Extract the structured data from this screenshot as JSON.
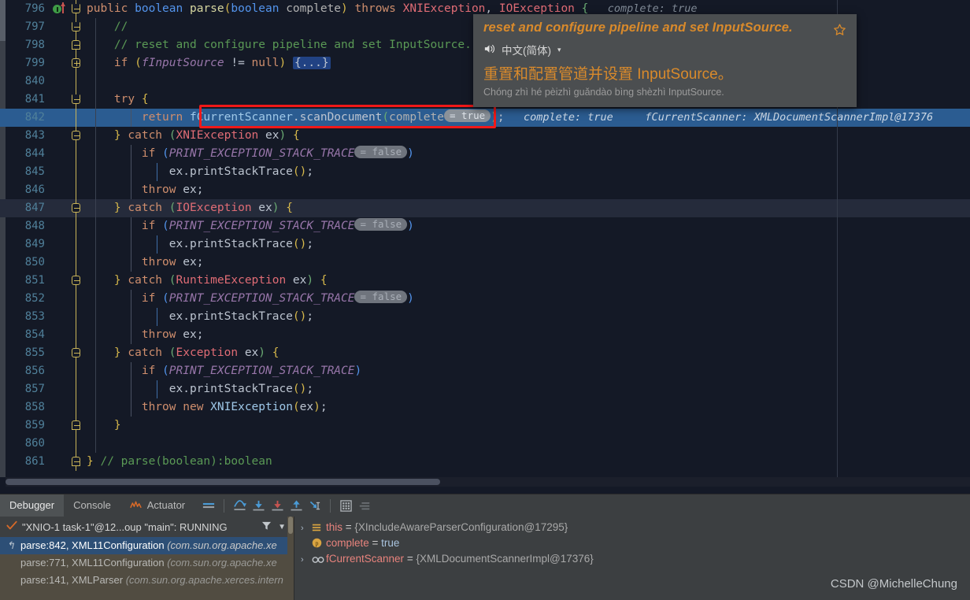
{
  "editor": {
    "lines": [
      {
        "num": "796",
        "indent": 0,
        "segments": [
          {
            "t": "public",
            "c": "kw"
          },
          {
            "t": " ",
            "c": "punc"
          },
          {
            "t": "boolean",
            "c": "kw2"
          },
          {
            "t": " ",
            "c": "punc"
          },
          {
            "t": "parse",
            "c": "fn"
          },
          {
            "t": "(",
            "c": "brkt-y"
          },
          {
            "t": "boolean",
            "c": "kw2"
          },
          {
            "t": " ",
            "c": "punc"
          },
          {
            "t": "complete",
            "c": "par"
          },
          {
            "t": ")",
            "c": "brkt-y"
          },
          {
            "t": " ",
            "c": "punc"
          },
          {
            "t": "throws",
            "c": "kw"
          },
          {
            "t": " ",
            "c": "punc"
          },
          {
            "t": "XNIException",
            "c": "typ"
          },
          {
            "t": ", ",
            "c": "punc"
          },
          {
            "t": "IOException",
            "c": "typ"
          },
          {
            "t": " ",
            "c": "punc"
          },
          {
            "t": "{",
            "c": "brkt-g"
          },
          {
            "t": "   complete: true",
            "c": "inl"
          }
        ]
      },
      {
        "num": "797",
        "segments": [
          {
            "t": "    //",
            "c": "cmt"
          }
        ]
      },
      {
        "num": "798",
        "segments": [
          {
            "t": "    // reset and configure pipeline and set InputSource.",
            "c": "cmt"
          }
        ]
      },
      {
        "num": "799",
        "segments": [
          {
            "t": "    ",
            "c": "punc"
          },
          {
            "t": "if",
            "c": "kw"
          },
          {
            "t": " ",
            "c": "punc"
          },
          {
            "t": "(",
            "c": "brkt-y"
          },
          {
            "t": "fInputSource",
            "c": "fld"
          },
          {
            "t": " != ",
            "c": "punc"
          },
          {
            "t": "null",
            "c": "kw"
          },
          {
            "t": ")",
            "c": "brkt-y"
          },
          {
            "t": " ",
            "c": "punc"
          },
          {
            "t": "{...}",
            "c": "folded"
          }
        ]
      },
      {
        "num": "840",
        "segments": []
      },
      {
        "num": "841",
        "segments": [
          {
            "t": "    ",
            "c": "punc"
          },
          {
            "t": "try",
            "c": "kw"
          },
          {
            "t": " ",
            "c": "punc"
          },
          {
            "t": "{",
            "c": "brkt-y"
          }
        ]
      },
      {
        "num": "842",
        "exec": true,
        "segments": [
          {
            "t": "        ",
            "c": "punc"
          },
          {
            "t": "return",
            "c": "kw"
          },
          {
            "t": " ",
            "c": "punc"
          },
          {
            "t": "fCurrentScanner",
            "c": "var"
          },
          {
            "t": ".",
            "c": "punc"
          },
          {
            "t": "scanDocument",
            "c": "punc"
          },
          {
            "t": "(",
            "c": "brkt-g"
          },
          {
            "t": "complete",
            "c": "par"
          },
          {
            "t": "= true",
            "c": "hint-bright"
          },
          {
            "t": ")",
            "c": "brkt-g"
          },
          {
            "t": ";",
            "c": "punc"
          },
          {
            "t": "   complete: true     fCurrentScanner: XMLDocumentScannerImpl@17376",
            "c": "inl-on-blue"
          }
        ]
      },
      {
        "num": "843",
        "segments": [
          {
            "t": "    ",
            "c": "punc"
          },
          {
            "t": "}",
            "c": "brkt-y"
          },
          {
            "t": " ",
            "c": "punc"
          },
          {
            "t": "catch",
            "c": "kw"
          },
          {
            "t": " ",
            "c": "punc"
          },
          {
            "t": "(",
            "c": "brkt-g"
          },
          {
            "t": "XNIException",
            "c": "typ"
          },
          {
            "t": " ex",
            "c": "punc"
          },
          {
            "t": ")",
            "c": "brkt-g"
          },
          {
            "t": " ",
            "c": "punc"
          },
          {
            "t": "{",
            "c": "brkt-y"
          }
        ]
      },
      {
        "num": "844",
        "segments": [
          {
            "t": "        ",
            "c": "punc"
          },
          {
            "t": "if",
            "c": "kw"
          },
          {
            "t": " ",
            "c": "punc"
          },
          {
            "t": "(",
            "c": "brkt-b"
          },
          {
            "t": "PRINT_EXCEPTION_STACK_TRACE",
            "c": "fld"
          },
          {
            "t": "= false",
            "c": "hint"
          },
          {
            "t": ")",
            "c": "brkt-b"
          }
        ]
      },
      {
        "num": "845",
        "segments": [
          {
            "t": "            ex",
            "c": "punc"
          },
          {
            "t": ".",
            "c": "punc"
          },
          {
            "t": "printStackTrace",
            "c": "punc"
          },
          {
            "t": "()",
            "c": "brkt-y"
          },
          {
            "t": ";",
            "c": "punc"
          }
        ]
      },
      {
        "num": "846",
        "segments": [
          {
            "t": "        ",
            "c": "punc"
          },
          {
            "t": "throw",
            "c": "kw"
          },
          {
            "t": " ex;",
            "c": "punc"
          }
        ]
      },
      {
        "num": "847",
        "hl": true,
        "segments": [
          {
            "t": "    ",
            "c": "punc"
          },
          {
            "t": "}",
            "c": "brkt-y"
          },
          {
            "t": " ",
            "c": "punc"
          },
          {
            "t": "catch",
            "c": "kw"
          },
          {
            "t": " ",
            "c": "punc"
          },
          {
            "t": "(",
            "c": "brkt-g"
          },
          {
            "t": "IOException",
            "c": "typ"
          },
          {
            "t": " ex",
            "c": "punc"
          },
          {
            "t": ")",
            "c": "brkt-g"
          },
          {
            "t": " ",
            "c": "punc"
          },
          {
            "t": "{",
            "c": "brkt-y"
          }
        ]
      },
      {
        "num": "848",
        "segments": [
          {
            "t": "        ",
            "c": "punc"
          },
          {
            "t": "if",
            "c": "kw"
          },
          {
            "t": " ",
            "c": "punc"
          },
          {
            "t": "(",
            "c": "brkt-b"
          },
          {
            "t": "PRINT_EXCEPTION_STACK_TRACE",
            "c": "fld"
          },
          {
            "t": "= false",
            "c": "hint"
          },
          {
            "t": ")",
            "c": "brkt-b"
          }
        ]
      },
      {
        "num": "849",
        "segments": [
          {
            "t": "            ex",
            "c": "punc"
          },
          {
            "t": ".",
            "c": "punc"
          },
          {
            "t": "printStackTrace",
            "c": "punc"
          },
          {
            "t": "()",
            "c": "brkt-y"
          },
          {
            "t": ";",
            "c": "punc"
          }
        ]
      },
      {
        "num": "850",
        "segments": [
          {
            "t": "        ",
            "c": "punc"
          },
          {
            "t": "throw",
            "c": "kw"
          },
          {
            "t": " ex;",
            "c": "punc"
          }
        ]
      },
      {
        "num": "851",
        "segments": [
          {
            "t": "    ",
            "c": "punc"
          },
          {
            "t": "}",
            "c": "brkt-y"
          },
          {
            "t": " ",
            "c": "punc"
          },
          {
            "t": "catch",
            "c": "kw"
          },
          {
            "t": " ",
            "c": "punc"
          },
          {
            "t": "(",
            "c": "brkt-g"
          },
          {
            "t": "RuntimeException",
            "c": "typ"
          },
          {
            "t": " ex",
            "c": "punc"
          },
          {
            "t": ")",
            "c": "brkt-g"
          },
          {
            "t": " ",
            "c": "punc"
          },
          {
            "t": "{",
            "c": "brkt-y"
          }
        ]
      },
      {
        "num": "852",
        "segments": [
          {
            "t": "        ",
            "c": "punc"
          },
          {
            "t": "if",
            "c": "kw"
          },
          {
            "t": " ",
            "c": "punc"
          },
          {
            "t": "(",
            "c": "brkt-b"
          },
          {
            "t": "PRINT_EXCEPTION_STACK_TRACE",
            "c": "fld"
          },
          {
            "t": "= false",
            "c": "hint"
          },
          {
            "t": ")",
            "c": "brkt-b"
          }
        ]
      },
      {
        "num": "853",
        "segments": [
          {
            "t": "            ex",
            "c": "punc"
          },
          {
            "t": ".",
            "c": "punc"
          },
          {
            "t": "printStackTrace",
            "c": "punc"
          },
          {
            "t": "()",
            "c": "brkt-y"
          },
          {
            "t": ";",
            "c": "punc"
          }
        ]
      },
      {
        "num": "854",
        "segments": [
          {
            "t": "        ",
            "c": "punc"
          },
          {
            "t": "throw",
            "c": "kw"
          },
          {
            "t": " ex;",
            "c": "punc"
          }
        ]
      },
      {
        "num": "855",
        "segments": [
          {
            "t": "    ",
            "c": "punc"
          },
          {
            "t": "}",
            "c": "brkt-y"
          },
          {
            "t": " ",
            "c": "punc"
          },
          {
            "t": "catch",
            "c": "kw"
          },
          {
            "t": " ",
            "c": "punc"
          },
          {
            "t": "(",
            "c": "brkt-g"
          },
          {
            "t": "Exception",
            "c": "typ"
          },
          {
            "t": " ex",
            "c": "punc"
          },
          {
            "t": ")",
            "c": "brkt-g"
          },
          {
            "t": " ",
            "c": "punc"
          },
          {
            "t": "{",
            "c": "brkt-y"
          }
        ]
      },
      {
        "num": "856",
        "segments": [
          {
            "t": "        ",
            "c": "punc"
          },
          {
            "t": "if",
            "c": "kw"
          },
          {
            "t": " ",
            "c": "punc"
          },
          {
            "t": "(",
            "c": "brkt-b"
          },
          {
            "t": "PRINT_EXCEPTION_STACK_TRACE",
            "c": "fld"
          },
          {
            "t": ")",
            "c": "brkt-b"
          }
        ]
      },
      {
        "num": "857",
        "segments": [
          {
            "t": "            ex",
            "c": "punc"
          },
          {
            "t": ".",
            "c": "punc"
          },
          {
            "t": "printStackTrace",
            "c": "punc"
          },
          {
            "t": "()",
            "c": "brkt-y"
          },
          {
            "t": ";",
            "c": "punc"
          }
        ]
      },
      {
        "num": "858",
        "segments": [
          {
            "t": "        ",
            "c": "punc"
          },
          {
            "t": "throw",
            "c": "kw"
          },
          {
            "t": " ",
            "c": "punc"
          },
          {
            "t": "new",
            "c": "kw"
          },
          {
            "t": " ",
            "c": "punc"
          },
          {
            "t": "XNIException",
            "c": "var"
          },
          {
            "t": "(",
            "c": "brkt-y"
          },
          {
            "t": "ex",
            "c": "punc"
          },
          {
            "t": ")",
            "c": "brkt-y"
          },
          {
            "t": ";",
            "c": "punc"
          }
        ]
      },
      {
        "num": "859",
        "segments": [
          {
            "t": "    ",
            "c": "punc"
          },
          {
            "t": "}",
            "c": "brkt-y"
          }
        ]
      },
      {
        "num": "860",
        "segments": []
      },
      {
        "num": "861",
        "segments": [
          {
            "t": "}",
            "c": "brkt-y"
          },
          {
            "t": " // parse(boolean):boolean",
            "c": "cmt"
          }
        ]
      }
    ]
  },
  "popup": {
    "source_text": "reset and configure pipeline and set InputSource.",
    "favorite_icon": "star-icon",
    "speaker_icon": "speaker-icon",
    "language": "中文(简体)",
    "language_caret": "▾",
    "translated_text": "重置和配置管道并设置 InputSource。",
    "pinyin": "Chóng zhì hé pèizhì guǎndào bìng shèzhì InputSource."
  },
  "toolwindow": {
    "tabs": [
      {
        "id": "debugger",
        "label": "Debugger",
        "active": true
      },
      {
        "id": "console",
        "label": "Console",
        "active": false
      },
      {
        "id": "actuator",
        "label": "Actuator",
        "active": false,
        "icon": "actuator-icon"
      }
    ],
    "toolbar": [
      {
        "id": "show-execution-point",
        "icon": "layout-icon"
      },
      {
        "id": "step-over",
        "icon": "step-over-icon"
      },
      {
        "id": "step-into",
        "icon": "step-into-icon"
      },
      {
        "id": "force-step-into",
        "icon": "force-step-into-icon"
      },
      {
        "id": "step-out",
        "icon": "step-out-icon"
      },
      {
        "id": "run-to-cursor",
        "icon": "run-to-cursor-icon"
      },
      {
        "id": "evaluate-expression",
        "icon": "calculator-icon"
      },
      {
        "id": "settings",
        "icon": "settings-lines-icon"
      }
    ],
    "thread": {
      "status_icon": "check-icon",
      "label": "\"XNIO-1 task-1\"@12...oup \"main\": RUNNING",
      "filter_icon": "filter-icon",
      "dropdown_icon": "chevron-down-icon"
    },
    "frames": [
      {
        "text": "parse:842, XML11Configuration (com.sun.org.apache.xe",
        "method": "parse:842, XML11Configuration",
        "pkg": " (com.sun.org.apache.xe",
        "selected": true,
        "rewind_icon": "rewind-icon"
      },
      {
        "text": "parse:771, XML11Configuration (com.sun.org.apache.xe",
        "method": "parse:771, XML11Configuration",
        "pkg": " (com.sun.org.apache.xe",
        "selected": false
      },
      {
        "text": "parse:141, XMLParser (com.sun.org.apache.xerces.intern",
        "method": "parse:141, XMLParser",
        "pkg": " (com.sun.org.apache.xerces.intern",
        "selected": false
      }
    ],
    "variables": [
      {
        "chevron": "›",
        "icon": "object-icon",
        "name": "this",
        "eq": " = ",
        "value": "{XIncludeAwareParserConfiguration@17295}",
        "bool": false
      },
      {
        "chevron": "",
        "icon": "primitive-icon",
        "name": "complete",
        "eq": " = ",
        "value": "true",
        "bool": true
      },
      {
        "chevron": "›",
        "icon": "field-icon",
        "name": "fCurrentScanner",
        "eq": " = ",
        "value": "{XMLDocumentScannerImpl@17376}",
        "bool": false
      }
    ]
  },
  "watermark": {
    "text": "CSDN @MichelleChung"
  },
  "colors": {
    "editor_bg": "#141926",
    "exec_line": "#2b5c91",
    "red_highlight": "#f01818",
    "popup_bg": "#4b4e50",
    "popup_accent": "#d98a2b",
    "toolwindow_bg": "#3c3f41",
    "frames_bg": "#514c41",
    "frame_selected": "#2d4f76"
  }
}
